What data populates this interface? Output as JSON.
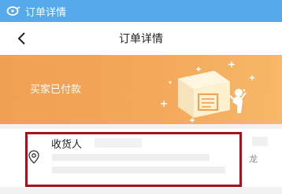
{
  "app_bar": {
    "icon": "app-logo-icon",
    "title": "订单详情",
    "color": "#56a9ea"
  },
  "nav": {
    "back_icon": "chevron-left-icon",
    "title": "订单详情"
  },
  "banner": {
    "status": "买家已付款",
    "color": "#f2a456",
    "illustration": "package-illustration"
  },
  "address": {
    "icon": "location-pin-icon",
    "label": "收货人",
    "tail": "龙",
    "highlight_color": "#a2141d"
  }
}
